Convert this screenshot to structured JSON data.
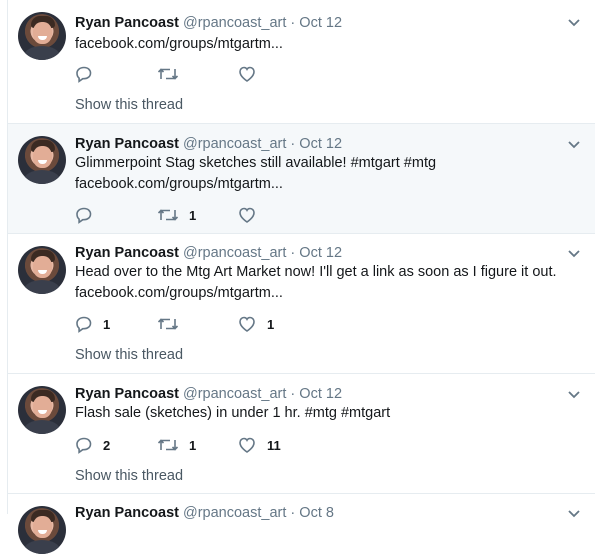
{
  "tweets": [
    {
      "name": "Ryan Pancoast",
      "handle": "@rpancoast_art",
      "dot": "·",
      "date": "Oct 12",
      "text": "",
      "link": "facebook.com/groups/mtgartm...",
      "reply_count": "",
      "retweet_count": "",
      "like_count": "",
      "show_thread": "Show this thread"
    },
    {
      "name": "Ryan Pancoast",
      "handle": "@rpancoast_art",
      "dot": "·",
      "date": "Oct 12",
      "text": "Glimmerpoint Stag sketches still available! #mtgart #mtg",
      "link": "facebook.com/groups/mtgartm...",
      "reply_count": "",
      "retweet_count": "1",
      "like_count": "",
      "show_thread": ""
    },
    {
      "name": "Ryan Pancoast",
      "handle": "@rpancoast_art",
      "dot": "·",
      "date": "Oct 12",
      "text": "Head over to the Mtg Art Market now! I'll get a link as soon as I figure it out.",
      "link": "facebook.com/groups/mtgartm...",
      "reply_count": "1",
      "retweet_count": "",
      "like_count": "1",
      "show_thread": "Show this thread"
    },
    {
      "name": "Ryan Pancoast",
      "handle": "@rpancoast_art",
      "dot": "·",
      "date": "Oct 12",
      "text": "Flash sale (sketches) in under 1 hr. #mtg #mtgart",
      "link": "",
      "reply_count": "2",
      "retweet_count": "1",
      "like_count": "11",
      "show_thread": "Show this thread"
    },
    {
      "name": "Ryan Pancoast",
      "handle": "@rpancoast_art",
      "dot": "·",
      "date": "Oct 8"
    }
  ],
  "icons": {
    "reply": "reply-icon",
    "retweet": "retweet-icon",
    "like": "heart-icon",
    "more": "chevron-down-icon"
  },
  "colors": {
    "text": "#14171a",
    "secondary": "#657786",
    "highlight_bg": "#f5f8fa",
    "divider": "#e6ecf0"
  }
}
